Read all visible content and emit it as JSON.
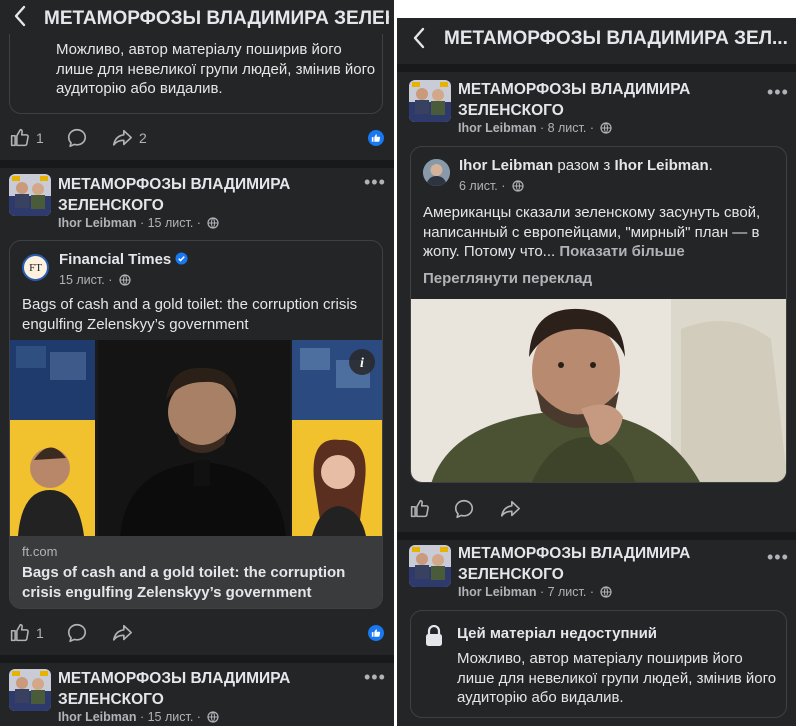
{
  "left": {
    "header": {
      "title": "МЕТАМОРФОЗЫ ВЛАДИМИРА ЗЕЛЕНСКОГО"
    },
    "top_card": {
      "text": "Можливо, автор матеріалу поширив його лише для невеликої групи людей, змінив його аудиторію або видалив."
    },
    "actions1": {
      "likes": "1",
      "shares": "2"
    },
    "post2": {
      "name_line1": "МЕТАМОРФОЗЫ ВЛАДИМИРА",
      "name_line2": "ЗЕЛЕНСКОГО",
      "author": "Ihor Leibman",
      "time": " · 15 лист. · ",
      "shared": {
        "source": "Financial Times",
        "source_logo": "FT",
        "source_time": "15 лист. · ",
        "text": "Bags of cash and a gold toilet: the corruption crisis engulfing Zelenskyy’s government",
        "domain": "ft.com",
        "link_title": "Bags of cash and a gold toilet: the corruption crisis engulfing Zelenskyy’s government"
      }
    },
    "actions2": {
      "likes": "1"
    },
    "post3": {
      "name_line1": "МЕТАМОРФОЗЫ ВЛАДИМИРА",
      "name_line2": "ЗЕЛЕНСКОГО",
      "author": "Ihor Leibman",
      "time": " · 15 лист. · "
    }
  },
  "right": {
    "header": {
      "title": "МЕТАМОРФОЗЫ ВЛАДИМИРА ЗЕЛ..."
    },
    "post1": {
      "name_line1": "МЕТАМОРФОЗЫ ВЛАДИМИРА",
      "name_line2": "ЗЕЛЕНСКОГО",
      "author": "Ihor Leibman",
      "time": " · 8 лист. · ",
      "shared": {
        "author": "Ihor Leibman",
        "with_text": " разом з ",
        "with_author": "Ihor Leibman",
        "dot": ".",
        "time": "6 лист. · ",
        "text": "Американцы сказали зеленскому засунуть свой, написанный с европейцами, \"мирный\" план — в жопу. Потому что...",
        "more": " Показати більше",
        "translate": "Переглянути переклад"
      }
    },
    "post2": {
      "name_line1": "МЕТАМОРФОЗЫ ВЛАДИМИРА",
      "name_line2": "ЗЕЛЕНСКОГО",
      "author": "Ihor Leibman",
      "time": " · 7 лист. · ",
      "unavailable_title": "Цей матеріал недоступний",
      "unavailable_text": "Можливо, автор матеріалу поширив його лише для невеликої групи людей, змінив його аудиторію або видалив."
    }
  },
  "colors": {
    "background": "#242526",
    "separator": "#18191a",
    "text": "#e4e6eb",
    "secondary": "#b0b3b8",
    "like_blue": "#1877f2",
    "ft_yellow": "#f2c12e"
  }
}
